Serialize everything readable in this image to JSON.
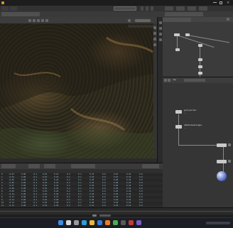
{
  "app": {
    "title": "",
    "accent": "#e08a2a"
  },
  "panels": {
    "network_path": "obj",
    "node_1_name": "grid_terrain",
    "node_1_sub": "...",
    "node_2_name": "attributewrangle",
    "node_2_sub": "..."
  },
  "spreadsheet": {
    "rows": [
      [
        "0",
        "-0.03",
        "0.00",
        "-0.1",
        "0.01",
        "0.21",
        "0.2",
        "0.1",
        "0.33",
        "0.0",
        "0.67",
        "0.19",
        "0.0"
      ],
      [
        "1",
        "-0.04",
        "0.00",
        "-0.1",
        "0.01",
        "0.22",
        "0.2",
        "0.1",
        "0.34",
        "0.0",
        "0.67",
        "0.19",
        "0.0"
      ],
      [
        "2",
        "-0.05",
        "0.00",
        "-0.1",
        "0.01",
        "0.22",
        "0.2",
        "0.1",
        "0.35",
        "0.0",
        "0.66",
        "0.19",
        "0.0"
      ],
      [
        "3",
        "-0.06",
        "0.00",
        "-0.1",
        "0.01",
        "0.23",
        "0.2",
        "0.1",
        "0.35",
        "0.0",
        "0.66",
        "0.19",
        "0.0"
      ],
      [
        "4",
        "-0.07",
        "0.00",
        "-0.1",
        "0.01",
        "0.24",
        "0.2",
        "0.1",
        "0.36",
        "0.0",
        "0.66",
        "0.19",
        "0.0"
      ],
      [
        "5",
        "-0.08",
        "0.00",
        "-0.1",
        "0.01",
        "0.25",
        "0.2",
        "0.1",
        "0.37",
        "0.0",
        "0.65",
        "0.19",
        "0.0"
      ],
      [
        "6",
        "-0.09",
        "0.00",
        "-0.1",
        "0.01",
        "0.25",
        "0.2",
        "0.1",
        "0.37",
        "0.0",
        "0.65",
        "0.19",
        "0.0"
      ],
      [
        "7",
        "-0.10",
        "0.00",
        "-0.1",
        "0.01",
        "0.26",
        "0.2",
        "0.1",
        "0.38",
        "0.0",
        "0.65",
        "0.19",
        "0.0"
      ],
      [
        "8",
        "-0.11",
        "0.00",
        "-0.1",
        "0.01",
        "0.27",
        "0.2",
        "0.1",
        "0.39",
        "0.0",
        "0.64",
        "0.19",
        "0.0"
      ],
      [
        "9",
        "-0.12",
        "0.00",
        "-0.1",
        "0.01",
        "0.28",
        "0.2",
        "0.1",
        "0.39",
        "0.0",
        "0.64",
        "0.19",
        "0.0"
      ],
      [
        "10",
        "-0.13",
        "0.00",
        "-0.1",
        "0.01",
        "0.28",
        "0.2",
        "0.1",
        "0.40",
        "0.0",
        "0.64",
        "0.19",
        "0.0"
      ],
      [
        "11",
        "-0.14",
        "0.00",
        "-0.1",
        "0.01",
        "0.29",
        "0.2",
        "0.1",
        "0.41",
        "0.0",
        "0.63",
        "0.19",
        "0.0"
      ]
    ]
  },
  "taskbar": {
    "icons": [
      {
        "name": "windows-start-icon",
        "color": "#3d8ee6"
      },
      {
        "name": "search-icon",
        "color": "#d7d7d7"
      },
      {
        "name": "task-view-icon",
        "color": "#9a9a9a"
      },
      {
        "name": "edge-icon",
        "color": "#2f9ed8"
      },
      {
        "name": "explorer-icon",
        "color": "#e7b93d"
      },
      {
        "name": "store-icon",
        "color": "#3a7bd5"
      },
      {
        "name": "houdini-icon",
        "color": "#f07d1e"
      },
      {
        "name": "chrome-icon",
        "color": "#4caf50"
      },
      {
        "name": "terminal-icon",
        "color": "#5a5a5a"
      },
      {
        "name": "app-icon",
        "color": "#c23c3c"
      },
      {
        "name": "app-icon-2",
        "color": "#7a5cc9"
      }
    ]
  }
}
